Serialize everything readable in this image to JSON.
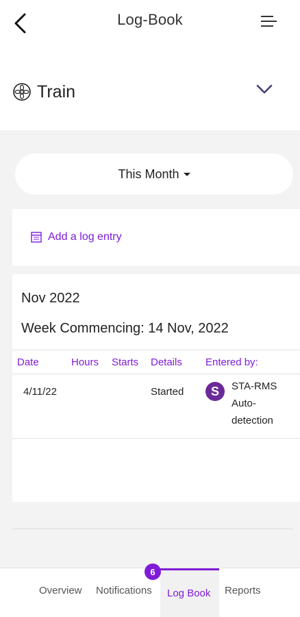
{
  "header": {
    "title": "Log-Book",
    "back_icon": "chevron-left-icon",
    "menu_icon": "menu-icon"
  },
  "asset": {
    "name": "Train",
    "icon": "wheel-icon",
    "toggle_icon": "chevron-down-icon"
  },
  "filter": {
    "period": "This Month"
  },
  "actions": {
    "add_entry_label": "Add a log entry",
    "add_entry_icon": "calendar-icon"
  },
  "log": {
    "month": "Nov 2022",
    "week": "Week Commencing: 14 Nov, 2022",
    "columns": [
      "Date",
      "Hours",
      "Starts",
      "Details",
      "Entered by:"
    ],
    "rows": [
      {
        "date": "4/11/22",
        "hours": "",
        "starts": "",
        "details": "Started",
        "avatar_letter": "S",
        "entered_by": "STA-RMS Auto-detection"
      }
    ]
  },
  "bottom_nav": {
    "tabs": [
      "Overview",
      "Notifications",
      "Log Book",
      "Reports"
    ],
    "active": "Log Book",
    "badge_count": "6"
  },
  "colors": {
    "accent": "#7f1bd6",
    "avatar": "#6b2a9b",
    "background": "#f3f3f3"
  }
}
